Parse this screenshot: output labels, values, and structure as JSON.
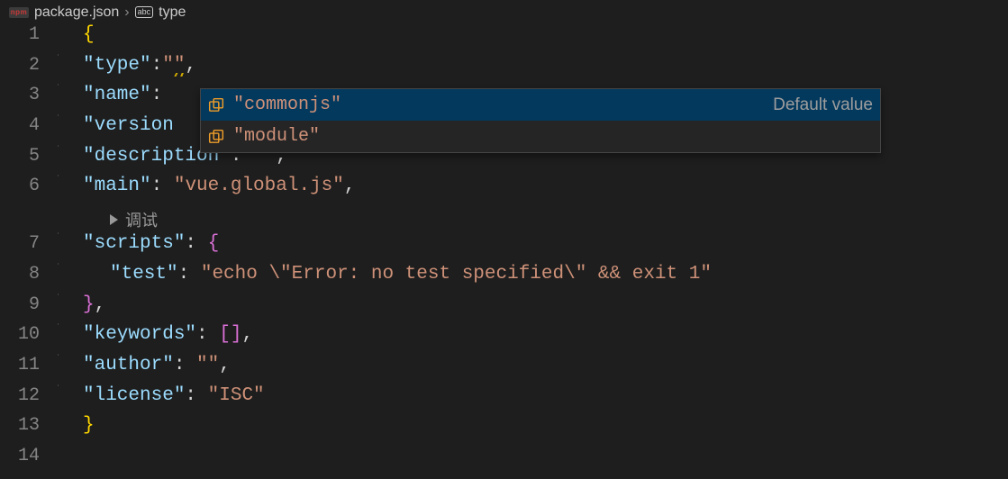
{
  "breadcrumb": {
    "file_icon": "npm",
    "file": "package.json",
    "separator": "›",
    "symbol_icon": "abc",
    "symbol": "type"
  },
  "codelens": {
    "debug": "调试"
  },
  "lines": [
    {
      "num": 1,
      "tokens": [
        {
          "t": "{",
          "c": "brace"
        }
      ],
      "indent": false
    },
    {
      "num": 2,
      "tokens": [
        {
          "t": "\"type\"",
          "c": "key"
        },
        {
          "t": ":",
          "c": "punct"
        },
        {
          "t": "\"",
          "c": "string"
        },
        {
          "t": "\"",
          "c": "string",
          "squiggly": true
        },
        {
          "t": ",",
          "c": "punct"
        }
      ],
      "indent": true
    },
    {
      "num": 3,
      "tokens": [
        {
          "t": "\"name\"",
          "c": "key"
        },
        {
          "t": ": ",
          "c": "punct"
        }
      ],
      "indent": true
    },
    {
      "num": 4,
      "tokens": [
        {
          "t": "\"version",
          "c": "key"
        }
      ],
      "indent": true
    },
    {
      "num": 5,
      "tokens": [
        {
          "t": "\"description\"",
          "c": "key"
        },
        {
          "t": ": ",
          "c": "punct"
        },
        {
          "t": "\"\"",
          "c": "string"
        },
        {
          "t": ",",
          "c": "punct"
        }
      ],
      "indent": true
    },
    {
      "num": 6,
      "tokens": [
        {
          "t": "\"main\"",
          "c": "key"
        },
        {
          "t": ": ",
          "c": "punct"
        },
        {
          "t": "\"vue.global.js\"",
          "c": "string"
        },
        {
          "t": ",",
          "c": "punct"
        }
      ],
      "indent": true
    },
    {
      "num": 7,
      "tokens": [
        {
          "t": "\"scripts\"",
          "c": "key"
        },
        {
          "t": ": ",
          "c": "punct"
        },
        {
          "t": "{",
          "c": "brace-inner"
        }
      ],
      "indent": true
    },
    {
      "num": 8,
      "tokens": [
        {
          "t": "\"test\"",
          "c": "key",
          "nest": 1
        },
        {
          "t": ": ",
          "c": "punct"
        },
        {
          "t": "\"echo \\\"Error: no test specified\\\" && exit 1\"",
          "c": "string"
        }
      ],
      "indent": true
    },
    {
      "num": 9,
      "tokens": [
        {
          "t": "}",
          "c": "brace-inner"
        },
        {
          "t": ",",
          "c": "punct"
        }
      ],
      "indent": true
    },
    {
      "num": 10,
      "tokens": [
        {
          "t": "\"keywords\"",
          "c": "key"
        },
        {
          "t": ": ",
          "c": "punct"
        },
        {
          "t": "[",
          "c": "bracket-sq"
        },
        {
          "t": "]",
          "c": "bracket-sq"
        },
        {
          "t": ",",
          "c": "punct"
        }
      ],
      "indent": true
    },
    {
      "num": 11,
      "tokens": [
        {
          "t": "\"author\"",
          "c": "key"
        },
        {
          "t": ": ",
          "c": "punct"
        },
        {
          "t": "\"\"",
          "c": "string"
        },
        {
          "t": ",",
          "c": "punct"
        }
      ],
      "indent": true
    },
    {
      "num": 12,
      "tokens": [
        {
          "t": "\"license\"",
          "c": "key"
        },
        {
          "t": ": ",
          "c": "punct"
        },
        {
          "t": "\"ISC\"",
          "c": "string"
        }
      ],
      "indent": true
    },
    {
      "num": 13,
      "tokens": [
        {
          "t": "}",
          "c": "brace"
        }
      ],
      "indent": false
    },
    {
      "num": 14,
      "tokens": [],
      "indent": false
    }
  ],
  "codelens_after_line": 6,
  "suggest": {
    "items": [
      {
        "label": "\"commonjs\"",
        "detail": "Default value",
        "selected": true
      },
      {
        "label": "\"module\"",
        "detail": "",
        "selected": false
      }
    ]
  }
}
